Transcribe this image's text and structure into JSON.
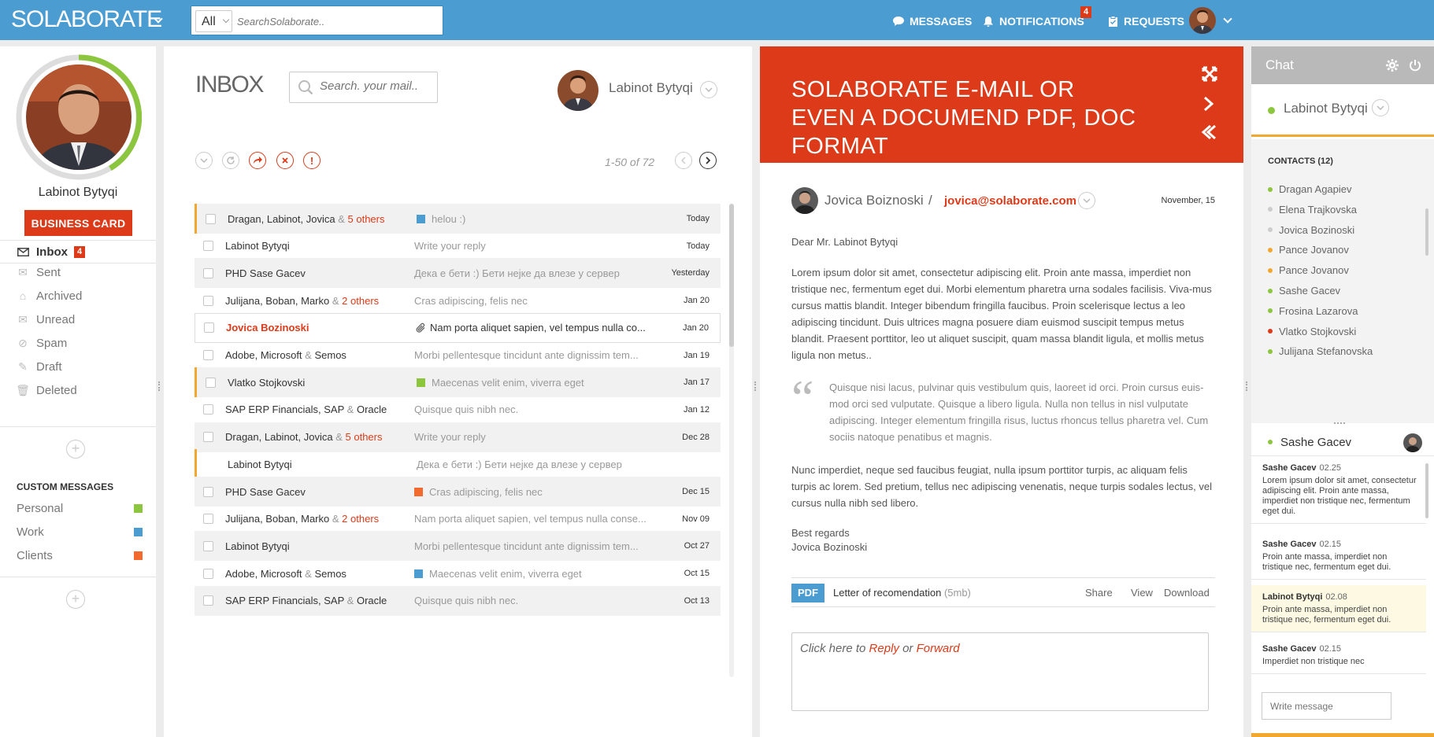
{
  "topbar": {
    "logo": "SOLABORATE",
    "search_scope": "All",
    "search_placeholder": "SearchSolaborate..",
    "messages_label": "MESSAGES",
    "notifications_label": "NOTIFICATIONS",
    "notifications_count": "4",
    "requests_label": "REQUESTS"
  },
  "profile": {
    "name": "Labinot Bytyqi",
    "business_card_label": "BUSINESS CARD"
  },
  "nav": {
    "items": [
      {
        "label": "Inbox",
        "icon": "envelope-icon",
        "badge": "4"
      },
      {
        "label": "Sent",
        "icon": "sent-icon"
      },
      {
        "label": "Archived",
        "icon": "archive-icon"
      },
      {
        "label": "Unread",
        "icon": "unread-icon"
      },
      {
        "label": "Spam",
        "icon": "spam-icon"
      },
      {
        "label": "Draft",
        "icon": "draft-icon"
      },
      {
        "label": "Deleted",
        "icon": "trash-icon"
      }
    ]
  },
  "custom_messages": {
    "title": "CUSTOM MESSAGES",
    "items": [
      {
        "label": "Personal",
        "color": "#8cc63e"
      },
      {
        "label": "Work",
        "color": "#4b9cd1"
      },
      {
        "label": "Clients",
        "color": "#f26a2e"
      }
    ]
  },
  "inbox": {
    "title": "INBOX",
    "search_placeholder": "Search. your mail..",
    "user_name": "Labinot Bytyqi",
    "pager": "1-50 of 72",
    "rows": [
      {
        "from": "Dragan, Labinot, Jovica",
        "amp": "&",
        "others": "5 others",
        "subject": "helou :)",
        "tag": "#4b9cd1",
        "date": "Today",
        "alt": true,
        "flag": true
      },
      {
        "from": "Labinot Bytyqi",
        "subject": "Write your reply",
        "date": "Today"
      },
      {
        "from": "PHD Sase Gacev",
        "subject": "Дека е бети :) Бети нејке да влезе у сервер",
        "date": "Yesterday",
        "alt": true
      },
      {
        "from": "Julijana, Boban, Marko",
        "amp": "&",
        "others": "2 others",
        "subject": "Cras adipiscing, felis nec",
        "date": "Jan 20"
      },
      {
        "from": "Jovica Bozinoski",
        "subject": "Nam porta aliquet sapien, vel tempus nulla co...",
        "date": "Jan 20",
        "selected": true,
        "attachment": true
      },
      {
        "from": "Adobe, Microsoft",
        "amp": "&",
        "others_plain": "Semos",
        "subject": "Morbi pellentesque tincidunt ante dignissim tem...",
        "date": "Jan 19"
      },
      {
        "from": "Vlatko Stojkovski",
        "subject": "Maecenas velit enim, viverra eget",
        "tag": "#8cc63e",
        "date": "Jan 17",
        "alt": true,
        "flag": true
      },
      {
        "from": "SAP ERP Financials, SAP",
        "amp": "&",
        "others_plain": "Oracle",
        "subject": "Quisque quis nibh nec.",
        "date": "Jan 12"
      },
      {
        "from": "Dragan, Labinot, Jovica",
        "amp": "&",
        "others": "5 others",
        "subject": "Write your reply",
        "date": "Dec 28",
        "alt": true
      },
      {
        "from": "Labinot Bytyqi",
        "subject": "Дека е бети :) Бети нејке да влезе у сервер",
        "date": "",
        "flag": true,
        "nocheck": true
      },
      {
        "from": "PHD Sase Gacev",
        "subject": "Cras adipiscing, felis nec",
        "tag": "#f26a2e",
        "date": "Dec 15",
        "alt": true
      },
      {
        "from": "Julijana, Boban, Marko",
        "amp": "&",
        "others": "2 others",
        "subject": "Nam porta aliquet sapien, vel tempus nulla conse...",
        "date": "Nov 09"
      },
      {
        "from": "Labinot Bytyqi",
        "subject": "Morbi pellentesque tincidunt ante dignissim tem...",
        "date": "Oct 27",
        "alt": true
      },
      {
        "from": "Adobe, Microsoft",
        "amp": "&",
        "others_plain": "Semos",
        "subject": "Maecenas velit enim, viverra eget",
        "tag": "#4b9cd1",
        "date": "Oct 15"
      },
      {
        "from": "SAP ERP Financials, SAP",
        "amp": "&",
        "others_plain": "Oracle",
        "subject": "Quisque quis nibh nec.",
        "date": "Oct 13",
        "alt": true
      }
    ]
  },
  "reader": {
    "title": "SOLABORATE E-MAIL OR EVEN A DOCUMEND PDF, DOC FORMAT",
    "sender_name": "Jovica Boiznoski",
    "slash": "/",
    "sender_email": "jovica@solaborate.com",
    "date": "November, 15",
    "greeting": "Dear Mr. Labinot Bytyqi",
    "para1": "Lorem ipsum dolor sit amet, consectetur adipiscing elit. Proin ante massa, imperdiet non tristique nec, fermentum eget dui. Morbi elementum pharetra urna sodales facilisis. Viva-mus cursus mattis blandit. Integer bibendum fringilla faucibus. Proin scelerisque lectus a leo adipiscing tincidunt. Duis ultrices magna posuere diam euismod suscipit tempus metus blandit. Praesent porttitor, leo ut aliquet suscipit, quam massa blandit ligula, et mollis metus ligula non metus..",
    "quote": "Quisque nisi lacus, pulvinar quis vestibulum quis, laoreet id orci. Proin cursus euis-mod orci sed vulputate. Quisque a libero ligula. Nulla non tellus in nisl vulputate adipiscing. Integer elementum fringilla risus, luctus rhoncus tellus pharetra vel. Cum sociis natoque penatibus et magnis.",
    "para2": "Nunc imperdiet, neque sed faucibus feugiat, nulla ipsum porttitor turpis, ac aliquam felis turpis ac lorem. Sed pretium, tellus nec adipiscing venenatis, neque turpis sodales lectus, vel cursus nulla nibh sed libero.",
    "sign1": "Best regards",
    "sign2": "Jovica Bozinoski",
    "attachment": {
      "type": "PDF",
      "name": "Letter of recomendation",
      "size": "(5mb)",
      "share": "Share",
      "view": "View",
      "download": "Download"
    },
    "reply_prefix": "Click here to",
    "reply_label": "Reply",
    "reply_or": "or",
    "forward_label": "Forward"
  },
  "chat": {
    "title": "Chat",
    "user_name": "Labinot Bytyqi",
    "contacts_title": "CONTACTS (12)",
    "contacts": [
      {
        "name": "Dragan Agapiev",
        "status": "#8cc63e"
      },
      {
        "name": "Elena Trajkovska",
        "status": "#cccccc"
      },
      {
        "name": "Jovica Bozinoski",
        "status": "#cccccc"
      },
      {
        "name": "Pance Jovanov",
        "status": "#f2a72e"
      },
      {
        "name": "Pance Jovanov",
        "status": "#f2a72e"
      },
      {
        "name": "Sashe Gacev",
        "status": "#8cc63e"
      },
      {
        "name": "Frosina Lazarova",
        "status": "#8cc63e"
      },
      {
        "name": "Vlatko Stojkovski",
        "status": "#dc3a19"
      },
      {
        "name": "Julijana Stefanovska",
        "status": "#8cc63e"
      }
    ],
    "conversation_with": "Sashe Gacev",
    "messages": [
      {
        "from": "Sashe Gacev",
        "time": "02.25",
        "text": "Lorem ipsum dolor sit amet, consectetur adipiscing elit. Proin ante massa, imperdiet non tristique nec, fermentum eget dui."
      },
      {
        "from": "Sashe Gacev",
        "time": "02.15",
        "text": "Proin ante massa, imperdiet non tristique nec, fermentum eget dui."
      },
      {
        "from": "Labinot Bytyqi",
        "time": "02.08",
        "text": "Proin ante massa, imperdiet non tristique nec, fermentum eget dui.",
        "highlight": true
      },
      {
        "from": "Sashe Gacev",
        "time": "02.15",
        "text": "Imperdiet non tristique nec"
      }
    ],
    "input_placeholder": "Write message"
  }
}
